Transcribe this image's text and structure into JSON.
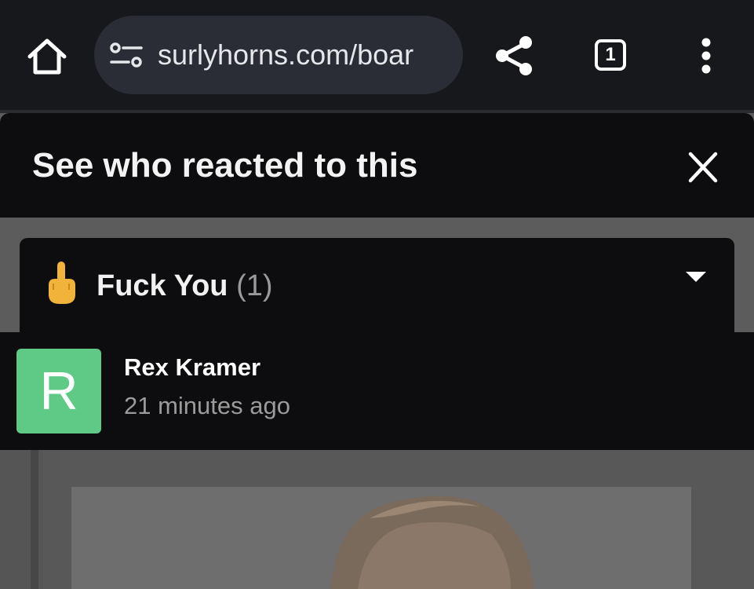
{
  "browser": {
    "url": "surlyhorns.com/boar",
    "tab_count": "1",
    "icons": {
      "home": "home-icon",
      "site_settings": "tune-icon",
      "share": "share-icon",
      "tabs": "tab-switcher-icon",
      "menu": "more-vert-icon"
    }
  },
  "sheet": {
    "title": "See who reacted to this",
    "close_icon": "close-icon"
  },
  "reaction": {
    "emoji_icon": "middle-finger-emoji",
    "label": "Fuck You",
    "count": "(1)",
    "caret_icon": "caret-down-icon"
  },
  "user": {
    "avatar_letter": "R",
    "avatar_color": "#5fc986",
    "name": "Rex Kramer",
    "time": "21 minutes ago"
  },
  "colors": {
    "topbar": "#17181c",
    "urlbar": "#2a2d35",
    "sheet": "#0d0d0f",
    "muted_text": "#9b9b9b"
  }
}
